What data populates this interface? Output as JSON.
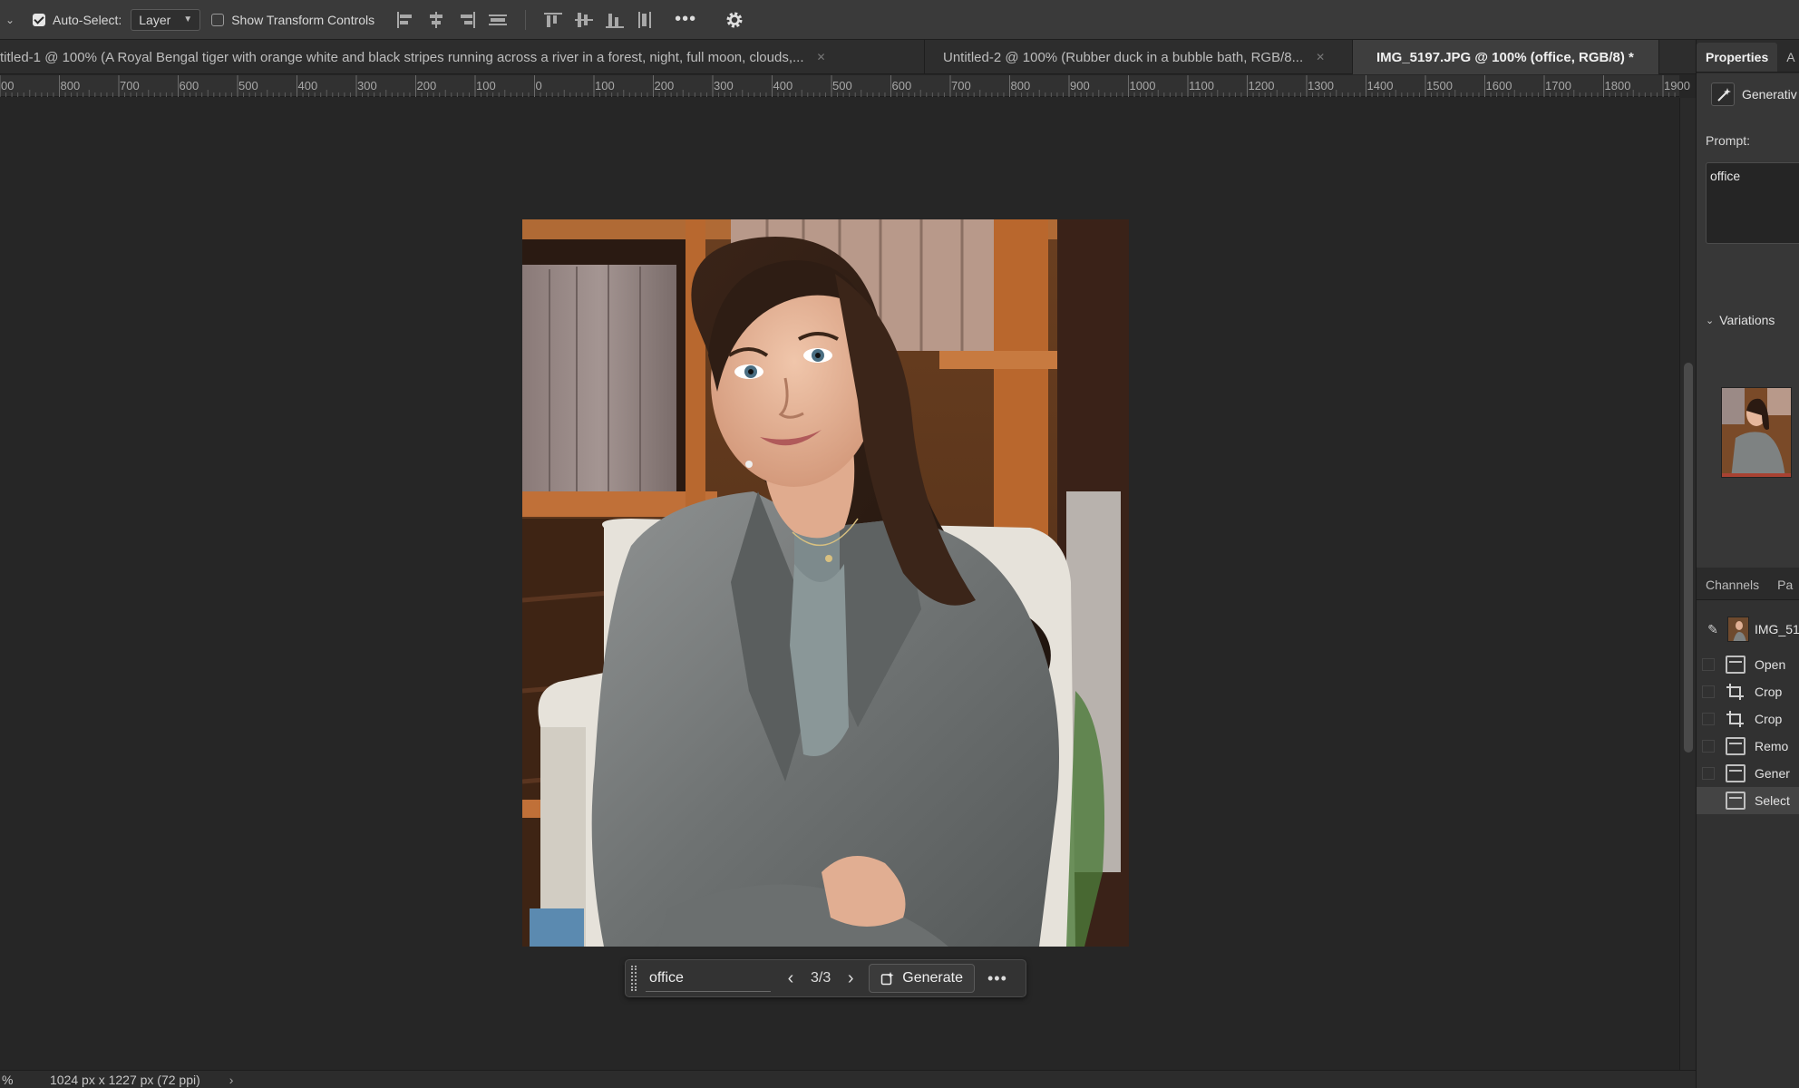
{
  "options_bar": {
    "auto_select_label": "Auto-Select:",
    "auto_select_checked": true,
    "layer_select_value": "Layer",
    "show_transform_label": "Show Transform Controls",
    "show_transform_checked": false,
    "more_label": "•••"
  },
  "tabs": [
    {
      "label": "titled-1 @ 100% (A Royal Bengal tiger with orange white and black stripes running across a river in a forest, night, full moon, clouds,...",
      "active": false
    },
    {
      "label": "Untitled-2 @ 100% (Rubber duck in a bubble bath, RGB/8...",
      "active": false
    },
    {
      "label": "IMG_5197.JPG @ 100% (office, RGB/8) *",
      "active": true
    }
  ],
  "ruler": {
    "labels": [
      "00",
      "800",
      "700",
      "600",
      "500",
      "400",
      "300",
      "200",
      "100",
      "0",
      "100",
      "200",
      "300",
      "400",
      "500",
      "600",
      "700",
      "800",
      "900",
      "1000",
      "1100",
      "1200",
      "1300",
      "1400",
      "1500",
      "1600",
      "1700",
      "1800",
      "1900"
    ]
  },
  "taskbar": {
    "prompt_value": "office",
    "counter": "3/3",
    "generate_label": "Generate",
    "more_label": "•••",
    "prev_icon": "‹",
    "next_icon": "›"
  },
  "status": {
    "zoom": "%",
    "dimensions": "1024 px x 1227 px (72 ppi)",
    "arrow": "›"
  },
  "panel": {
    "top_tabs": [
      "Properties",
      "A"
    ],
    "generative_label": "Generativ",
    "prompt_label": "Prompt:",
    "prompt_value": "office",
    "variations_label": "Variations",
    "bottom_tabs": [
      "Channels",
      "Pa"
    ],
    "snapshot_label": "IMG_51",
    "history": [
      {
        "label": "Open",
        "icon": "document-icon",
        "selected": false
      },
      {
        "label": "Crop",
        "icon": "crop-icon",
        "selected": false
      },
      {
        "label": "Crop",
        "icon": "crop-icon",
        "selected": false
      },
      {
        "label": "Remo",
        "icon": "document-icon",
        "selected": false
      },
      {
        "label": "Gener",
        "icon": "document-icon",
        "selected": false
      },
      {
        "label": "Select",
        "icon": "document-icon",
        "selected": true
      }
    ]
  },
  "colors": {
    "app_bg": "#262626",
    "panel_bg": "#373737",
    "bar_bg": "#3a3a3a"
  }
}
